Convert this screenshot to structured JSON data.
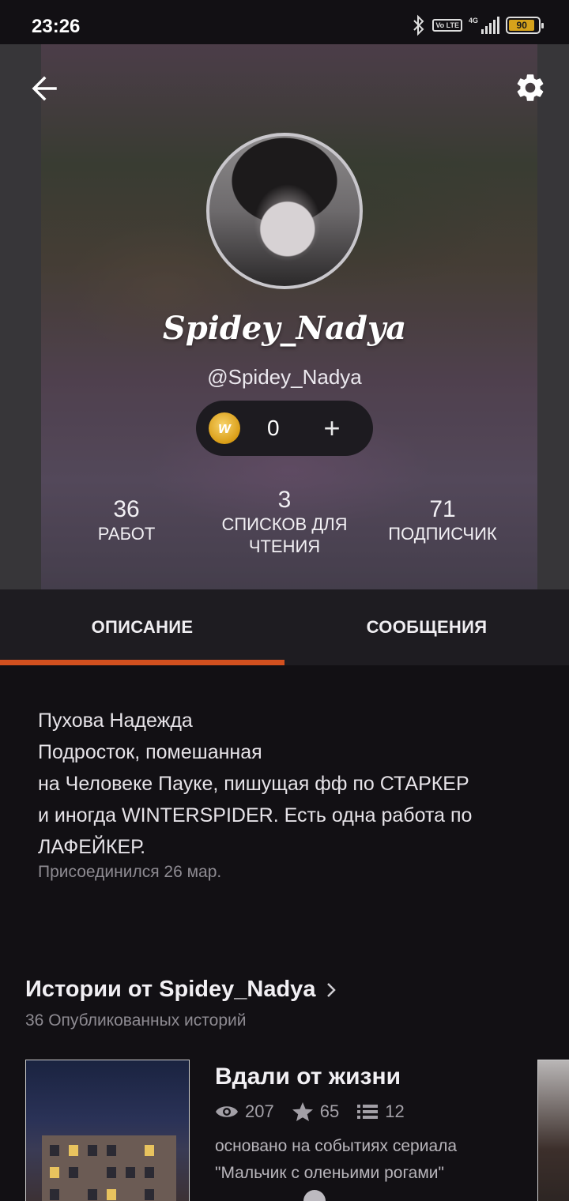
{
  "status_bar": {
    "time": "23:26",
    "network": "4G",
    "volte": "Vo LTE",
    "battery": "90"
  },
  "profile": {
    "display_name": "Spidey_Nadya",
    "handle": "@Spidey_Nadya",
    "coins": "0",
    "coins_add": "+",
    "coin_symbol": "w"
  },
  "stats": [
    {
      "value": "36",
      "label": "РАБОТ"
    },
    {
      "value": "3",
      "label": "СПИСКОВ ДЛЯ\nЧТЕНИЯ"
    },
    {
      "value": "71",
      "label": "ПОДПИСЧИК"
    }
  ],
  "tabs": [
    {
      "label": "ОПИСАНИЕ",
      "active": true
    },
    {
      "label": "СООБЩЕНИЯ",
      "active": false
    }
  ],
  "about": {
    "description": "Пухова Надежда\nПодросток, помешанная\nна Человеке Пауке, пишущая фф по СТАРКЕР\nи иногда WINTERSPIDER. Есть одна работа по\nЛАФЕЙКЕР.",
    "joined": "Присоединился 26 мар."
  },
  "stories": {
    "title": "Истории от Spidey_Nadya",
    "subtitle": "36 Опубликованных историй",
    "items": [
      {
        "title": "Вдали от жизни",
        "reads": "207",
        "votes": "65",
        "parts": "12",
        "blurb": "основано на событиях сериала \"Мальчик с оленьими рогами\""
      }
    ]
  },
  "colors": {
    "accent": "#d2501f",
    "background": "#121014",
    "tabs_bg": "#1e1c21"
  }
}
